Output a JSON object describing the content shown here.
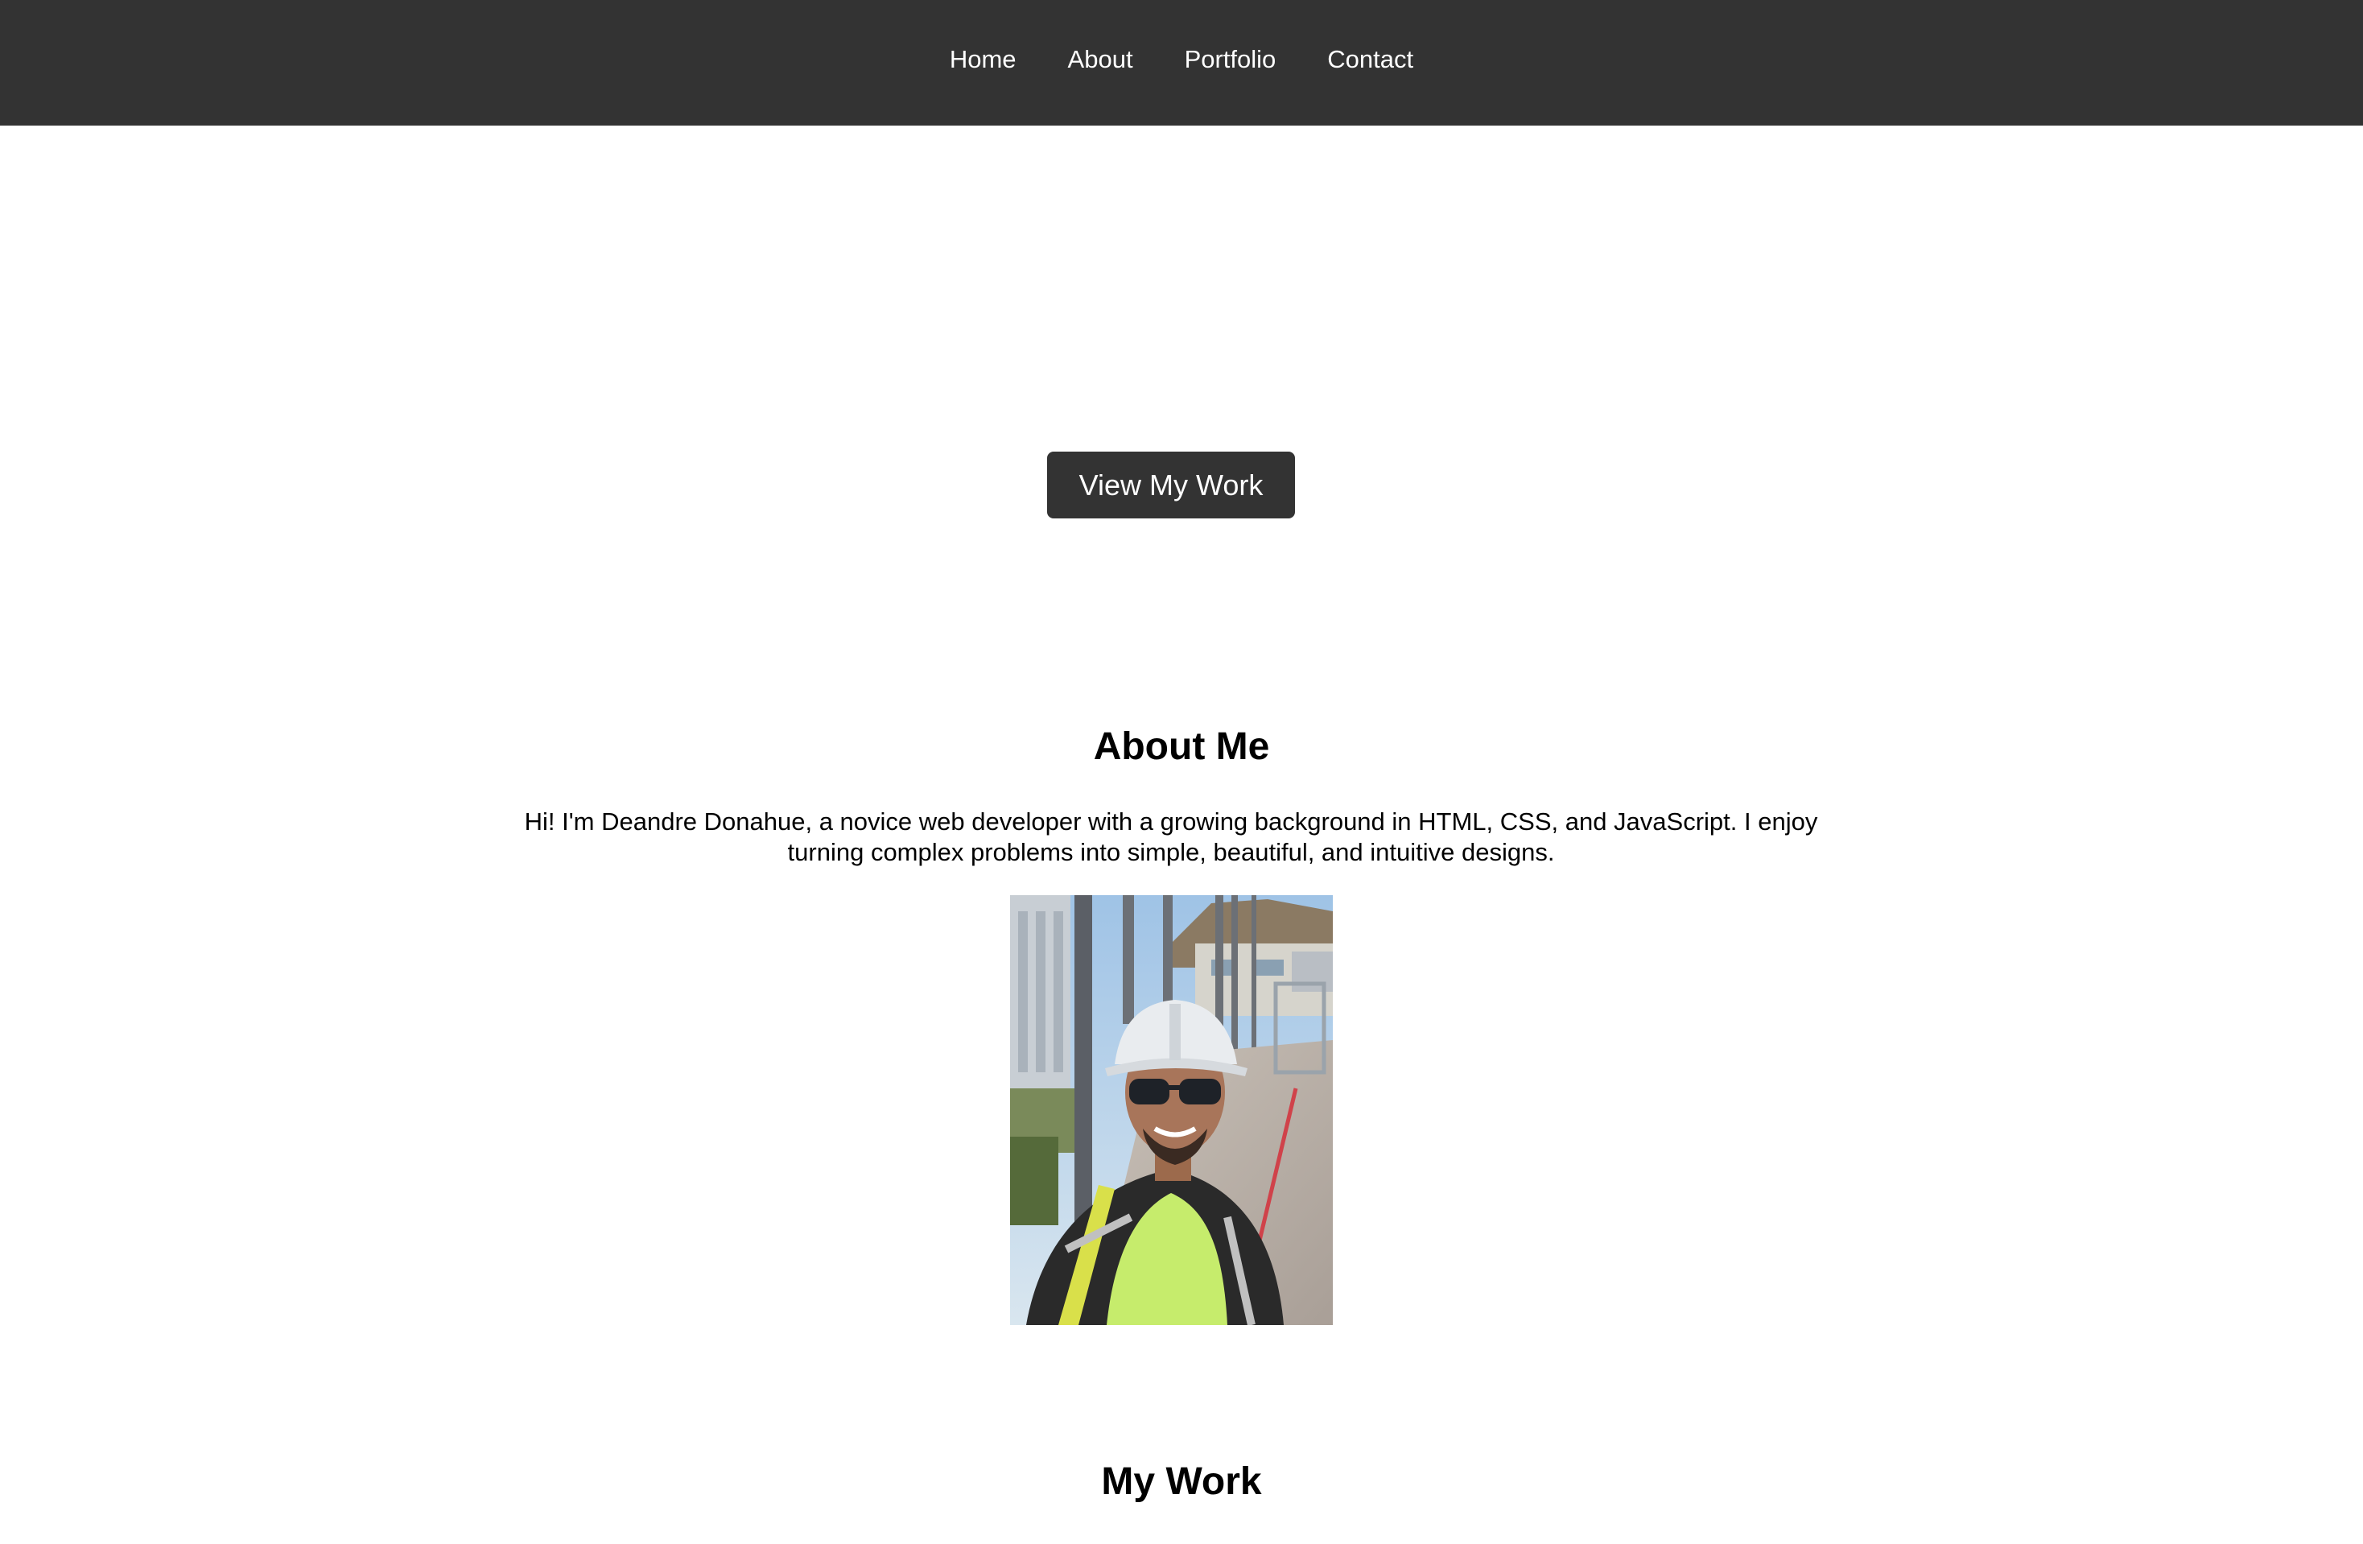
{
  "nav": {
    "items": [
      {
        "label": "Home"
      },
      {
        "label": "About"
      },
      {
        "label": "Portfolio"
      },
      {
        "label": "Contact"
      }
    ]
  },
  "hero": {
    "button_label": "View My Work"
  },
  "about": {
    "title": "About Me",
    "text": "Hi! I'm Deandre Donahue, a novice web developer with a growing background in HTML, CSS, and JavaScript. I enjoy turning complex problems into simple, beautiful, and intuitive designs.",
    "photo_icon": "profile-photo"
  },
  "work": {
    "title": "My Work"
  },
  "colors": {
    "nav_background": "#333333",
    "button_background": "#333333",
    "nav_text": "#ffffff",
    "page_background": "#ffffff"
  }
}
